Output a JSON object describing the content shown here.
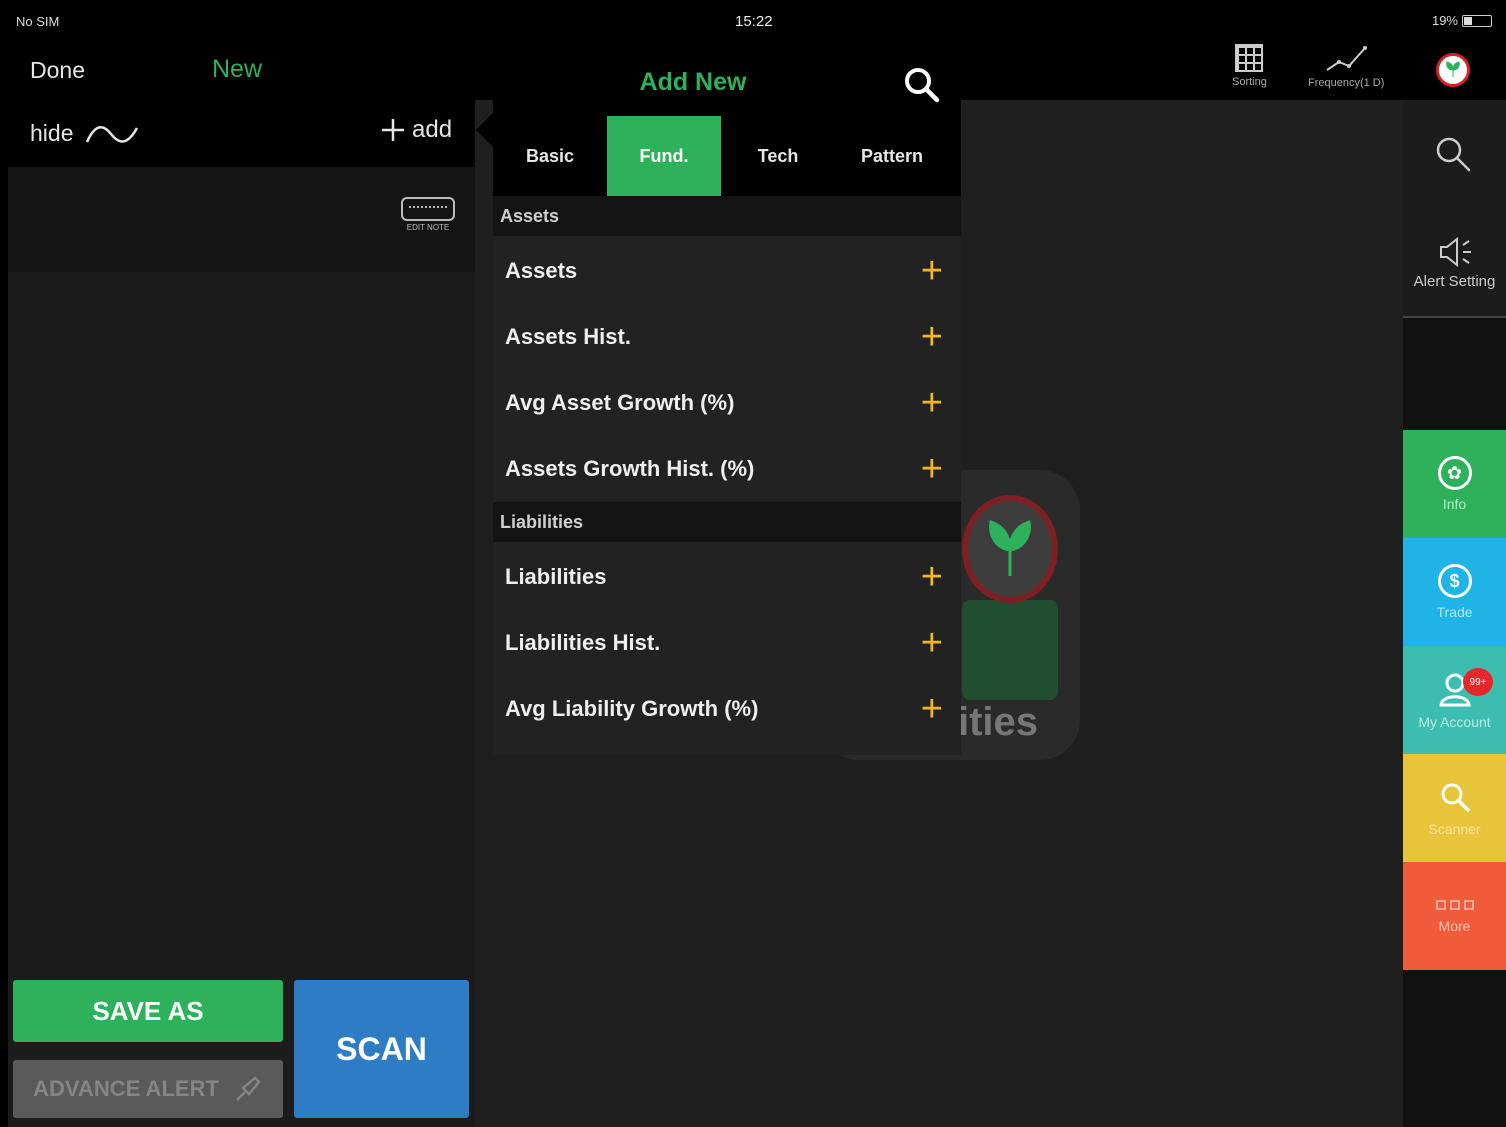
{
  "status_bar": {
    "carrier": "No SIM",
    "time": "15:22",
    "battery": "19%"
  },
  "left_panel": {
    "done_label": "Done",
    "new_label": "New",
    "hide_label": "hide",
    "add_label": "add",
    "edit_note_label": "EDIT NOTE",
    "save_as_label": "SAVE AS",
    "advance_alert_label": "ADVANCE ALERT",
    "scan_label": "SCAN"
  },
  "header": {
    "sorting_label": "Sorting",
    "frequency_label": "Frequency(1 D)"
  },
  "popover": {
    "title": "Add New",
    "tabs": [
      {
        "label": "Basic",
        "active": false
      },
      {
        "label": "Fund.",
        "active": true
      },
      {
        "label": "Tech",
        "active": false
      },
      {
        "label": "Pattern",
        "active": false
      }
    ],
    "sections": [
      {
        "header": "Assets",
        "items": [
          "Assets",
          "Assets Hist.",
          "Avg Asset Growth (%)",
          "Assets Growth Hist. (%)"
        ]
      },
      {
        "header": "Liabilities",
        "items": [
          "Liabilities",
          "Liabilities Hist.",
          "Avg Liability Growth (%)"
        ]
      }
    ]
  },
  "background_logo_text": "ities",
  "right_sidebar": {
    "alert_setting_label": "Alert Setting",
    "info_label": "Info",
    "trade_label": "Trade",
    "account_label": "My Account",
    "account_badge": "99+",
    "scanner_label": "Scanner",
    "more_label": "More"
  },
  "colors": {
    "green": "#2db15a",
    "blue": "#2d7cc4",
    "plus_yellow": "#f0b52b",
    "trade_blue": "#1fb3e6",
    "account_teal": "#3dbdb0",
    "scanner_yellow": "#e8c43a",
    "more_orange": "#f05b3a"
  }
}
